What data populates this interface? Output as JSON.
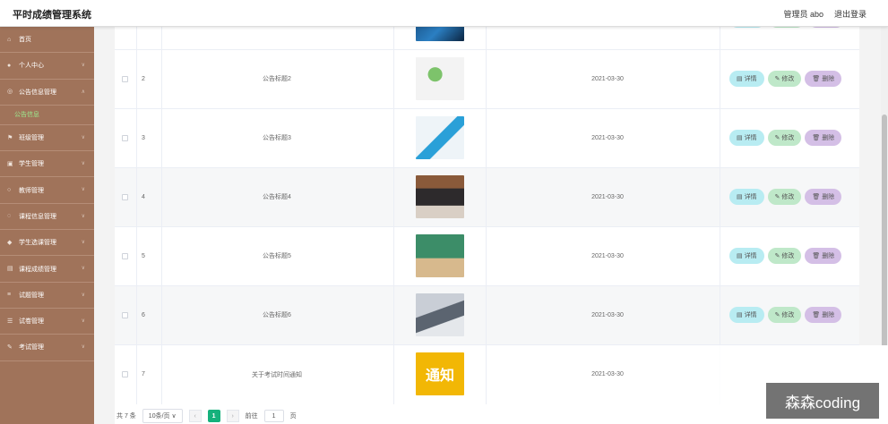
{
  "header": {
    "title": "平时成绩管理系统",
    "user": "管理员 abo",
    "logout": "退出登录"
  },
  "sidebar": {
    "items": [
      {
        "label": "首页",
        "icon": "home-icon"
      },
      {
        "label": "个人中心",
        "icon": "user-icon"
      },
      {
        "label": "公告信息管理",
        "icon": "notice-icon",
        "submenu": "公告信息"
      },
      {
        "label": "班级管理",
        "icon": "flag-icon"
      },
      {
        "label": "学生管理",
        "icon": "student-icon"
      },
      {
        "label": "教师管理",
        "icon": "teacher-icon"
      },
      {
        "label": "课程信息管理",
        "icon": "course-icon"
      },
      {
        "label": "学生选课管理",
        "icon": "select-icon"
      },
      {
        "label": "课程成绩管理",
        "icon": "score-icon"
      },
      {
        "label": "试题管理",
        "icon": "question-icon"
      },
      {
        "label": "试卷管理",
        "icon": "paper-icon"
      },
      {
        "label": "考试管理",
        "icon": "exam-icon"
      }
    ]
  },
  "table": {
    "rows": [
      {
        "index": "2",
        "title": "公告标题2",
        "date": "2021-03-30",
        "image": "classroom-illustration"
      },
      {
        "index": "3",
        "title": "公告标题3",
        "date": "2021-03-30",
        "image": "online-class-illustration"
      },
      {
        "index": "4",
        "title": "公告标题4",
        "date": "2021-03-30",
        "image": "classroom-photo"
      },
      {
        "index": "5",
        "title": "公告标题5",
        "date": "2021-03-30",
        "image": "chalkboard-illustration"
      },
      {
        "index": "6",
        "title": "公告标题6",
        "date": "2021-03-30",
        "image": "tablet-photo"
      },
      {
        "index": "7",
        "title": "关于考试时间通知",
        "date": "2021-03-30",
        "image": "notice-banner",
        "image_text": "通知"
      }
    ],
    "actions": {
      "detail": "详情",
      "edit": "修改",
      "delete": "删除"
    }
  },
  "pagination": {
    "total": "共 7 条",
    "page_size": "10条/页",
    "current": "1",
    "goto_label": "前往",
    "goto_value": "1",
    "page_suffix": "页"
  },
  "watermark": "森森coding",
  "colors": {
    "sidebar": "#a0735a",
    "accent": "#15b17c",
    "submenu": "#9bea8f"
  }
}
